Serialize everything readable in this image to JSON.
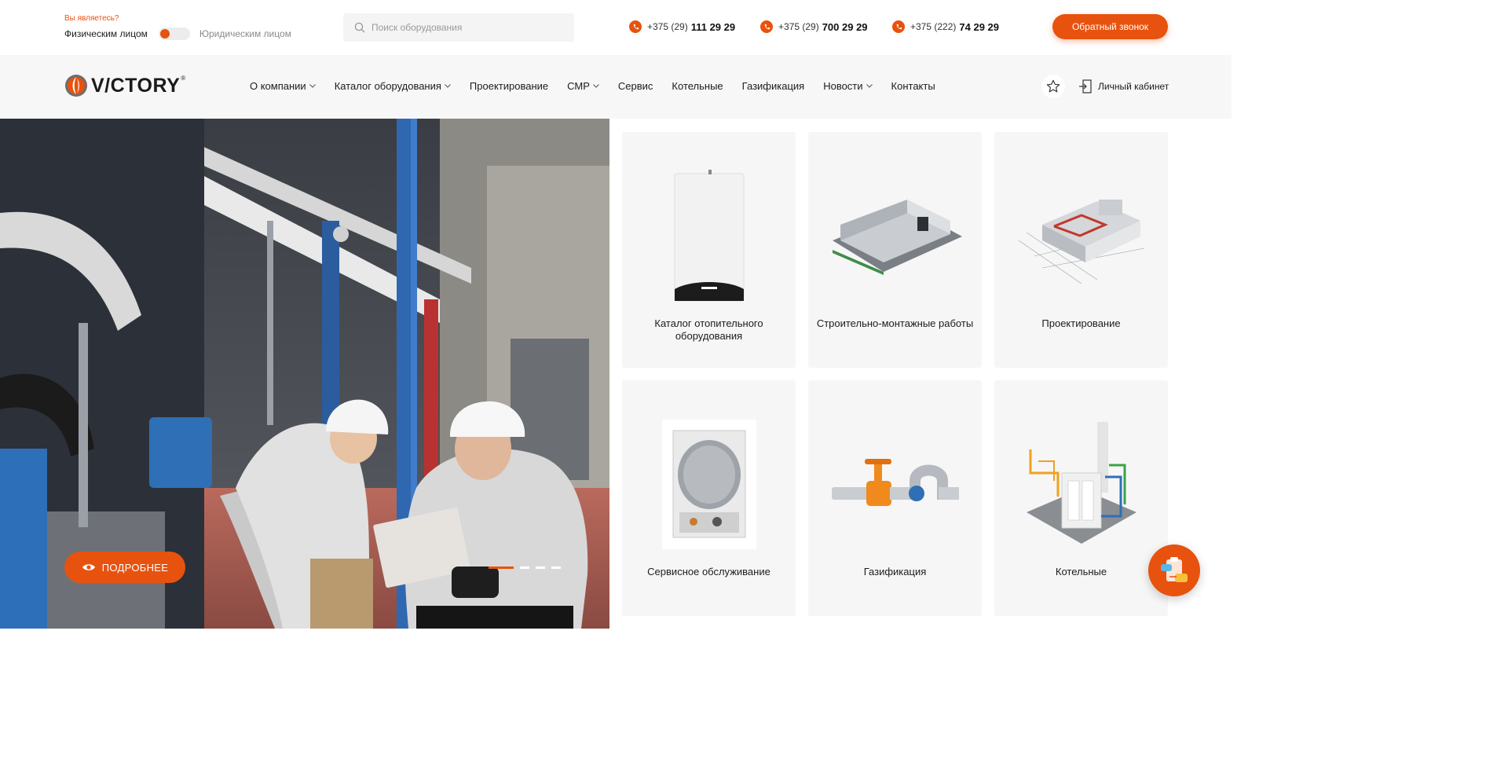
{
  "audience": {
    "question": "Вы являетесь?",
    "physical": "Физическим лицом",
    "legal": "Юридическим лицом"
  },
  "search": {
    "placeholder": "Поиск оборудования"
  },
  "phones": [
    {
      "code": "+375 (29)",
      "number": "111 29 29"
    },
    {
      "code": "+375 (29)",
      "number": "700 29 29"
    },
    {
      "code": "+375 (222)",
      "number": "74 29 29"
    }
  ],
  "callback_label": "Обратный звонок",
  "logo": {
    "text": "V/CTORY",
    "reg": "®"
  },
  "nav": [
    {
      "label": "О компании",
      "dropdown": true
    },
    {
      "label": "Каталог оборудования",
      "dropdown": true
    },
    {
      "label": "Проектирование",
      "dropdown": false
    },
    {
      "label": "СМР",
      "dropdown": true
    },
    {
      "label": "Сервис",
      "dropdown": false
    },
    {
      "label": "Котельные",
      "dropdown": false
    },
    {
      "label": "Газификация",
      "dropdown": false
    },
    {
      "label": "Новости",
      "dropdown": true
    },
    {
      "label": "Контакты",
      "dropdown": false
    }
  ],
  "cabinet_label": "Личный кабинет",
  "hero": {
    "more_label": "ПОДРОБНЕЕ",
    "slides": 4,
    "active_slide": 1
  },
  "cards": [
    {
      "label": "Каталог отопительного оборудования",
      "icon": "boiler-icon"
    },
    {
      "label": "Строительно-монтажные работы",
      "icon": "building-icon"
    },
    {
      "label": "Проектирование",
      "icon": "blueprint-icon"
    },
    {
      "label": "Сервисное обслуживание",
      "icon": "boiler-open-icon"
    },
    {
      "label": "Газификация",
      "icon": "gas-pipe-icon"
    },
    {
      "label": "Котельные",
      "icon": "boiler-room-icon"
    }
  ],
  "colors": {
    "accent": "#e8520f",
    "panel": "#f6f6f6",
    "nav_bg": "#f7f7f7"
  }
}
